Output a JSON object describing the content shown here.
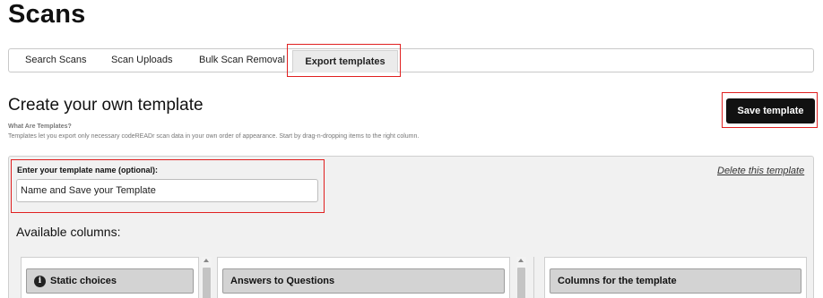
{
  "page": {
    "title": "Scans"
  },
  "tabs": [
    {
      "label": "Search Scans"
    },
    {
      "label": "Scan Uploads"
    },
    {
      "label": "Bulk Scan Removal"
    },
    {
      "label": "Export templates",
      "active": true
    }
  ],
  "template": {
    "heading": "Create your own template",
    "what_title": "What Are Templates?",
    "what_desc": "Templates let you export only necessary codeREADr scan data in your own order of appearance. Start by drag-n-dropping items to the right column.",
    "save_label": "Save template",
    "name_label": "Enter your template name (optional):",
    "name_value": "Name and Save your Template",
    "delete_label": "Delete this template",
    "available_label": "Available columns:"
  },
  "columns": [
    {
      "title": "Static choices",
      "icon": "info-icon"
    },
    {
      "title": "Answers to Questions"
    },
    {
      "title": "Columns for the template"
    }
  ],
  "highlight_color": "#e02020"
}
